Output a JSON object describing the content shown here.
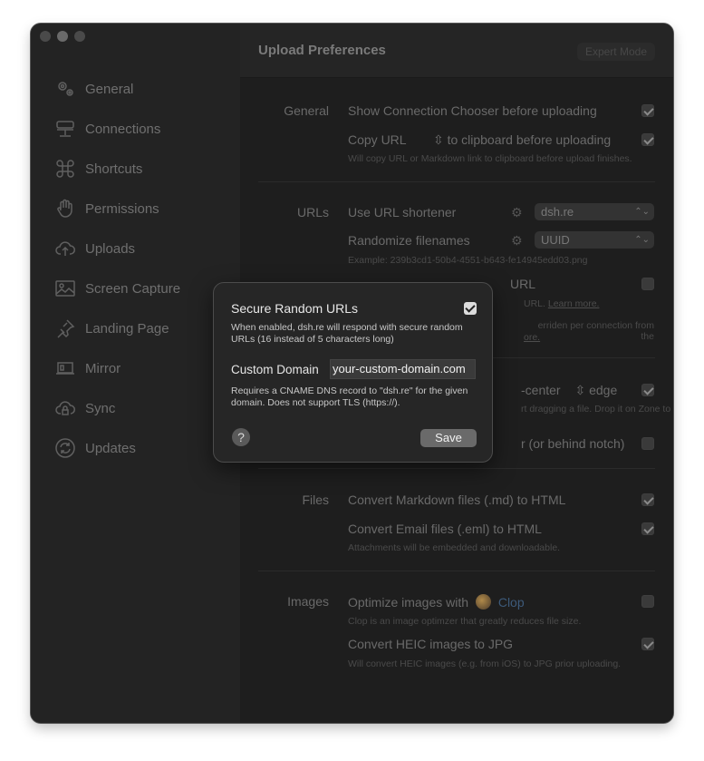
{
  "window": {
    "title": "Upload Preferences",
    "expert_mode": "Expert Mode"
  },
  "sidebar": {
    "items": [
      {
        "label": "General",
        "icon": "gears-icon"
      },
      {
        "label": "Connections",
        "icon": "server-icon"
      },
      {
        "label": "Shortcuts",
        "icon": "command-icon"
      },
      {
        "label": "Permissions",
        "icon": "hand-icon"
      },
      {
        "label": "Uploads",
        "icon": "cloud-upload-icon"
      },
      {
        "label": "Screen Capture",
        "icon": "photo-icon"
      },
      {
        "label": "Landing Page",
        "icon": "pin-icon"
      },
      {
        "label": "Mirror",
        "icon": "laptop-icon"
      },
      {
        "label": "Sync",
        "icon": "cloud-lock-icon"
      },
      {
        "label": "Updates",
        "icon": "refresh-icon"
      }
    ]
  },
  "sections": {
    "general": {
      "label": "General",
      "show_chooser": "Show Connection Chooser before uploading",
      "copy_url_select": "Copy URL",
      "copy_url_suffix": "to clipboard before uploading",
      "copy_hint": "Will copy URL or Markdown link to clipboard before upload finishes."
    },
    "urls": {
      "label": "URLs",
      "use_shortener": "Use URL shortener",
      "shortener_value": "dsh.re",
      "randomize": "Randomize filenames",
      "randomize_value": "UUID",
      "example": "Example: 239b3cd1-50b4-4551-b643-fe14945edd03.png",
      "partial_row": "URL",
      "partial_hint": "URL.",
      "learn_more": "Learn more.",
      "partial_hint2": "erriden per connection from the",
      "partial_more": "ore."
    },
    "dropzone": {
      "position_value": "-center",
      "edge_value": "edge",
      "hint": "rt dragging a file. Drop it on Zone to",
      "notch": "r (or behind notch)"
    },
    "files": {
      "label": "Files",
      "markdown": "Convert Markdown files (.md) to HTML",
      "email": "Convert Email files (.eml) to HTML",
      "email_hint": "Attachments will be embedded and downloadable."
    },
    "images": {
      "label": "Images",
      "optimize": "Optimize images with",
      "clop": "Clop",
      "clop_hint": "Clop is an image optimzer that greatly reduces file size.",
      "heic": "Convert HEIC images to JPG",
      "heic_hint": "Will convert HEIC images (e.g. from iOS) to JPG prior uploading."
    }
  },
  "modal": {
    "title": "Secure Random URLs",
    "desc1": "When enabled, dsh.re will respond with secure random URLs (16 instead of 5 characters long)",
    "domain_label": "Custom Domain",
    "domain_value": "your-custom-domain.com",
    "desc2": "Requires a CNAME DNS record to \"dsh.re\" for the given domain. Does not support TLS (https://).",
    "help": "?",
    "save": "Save"
  }
}
